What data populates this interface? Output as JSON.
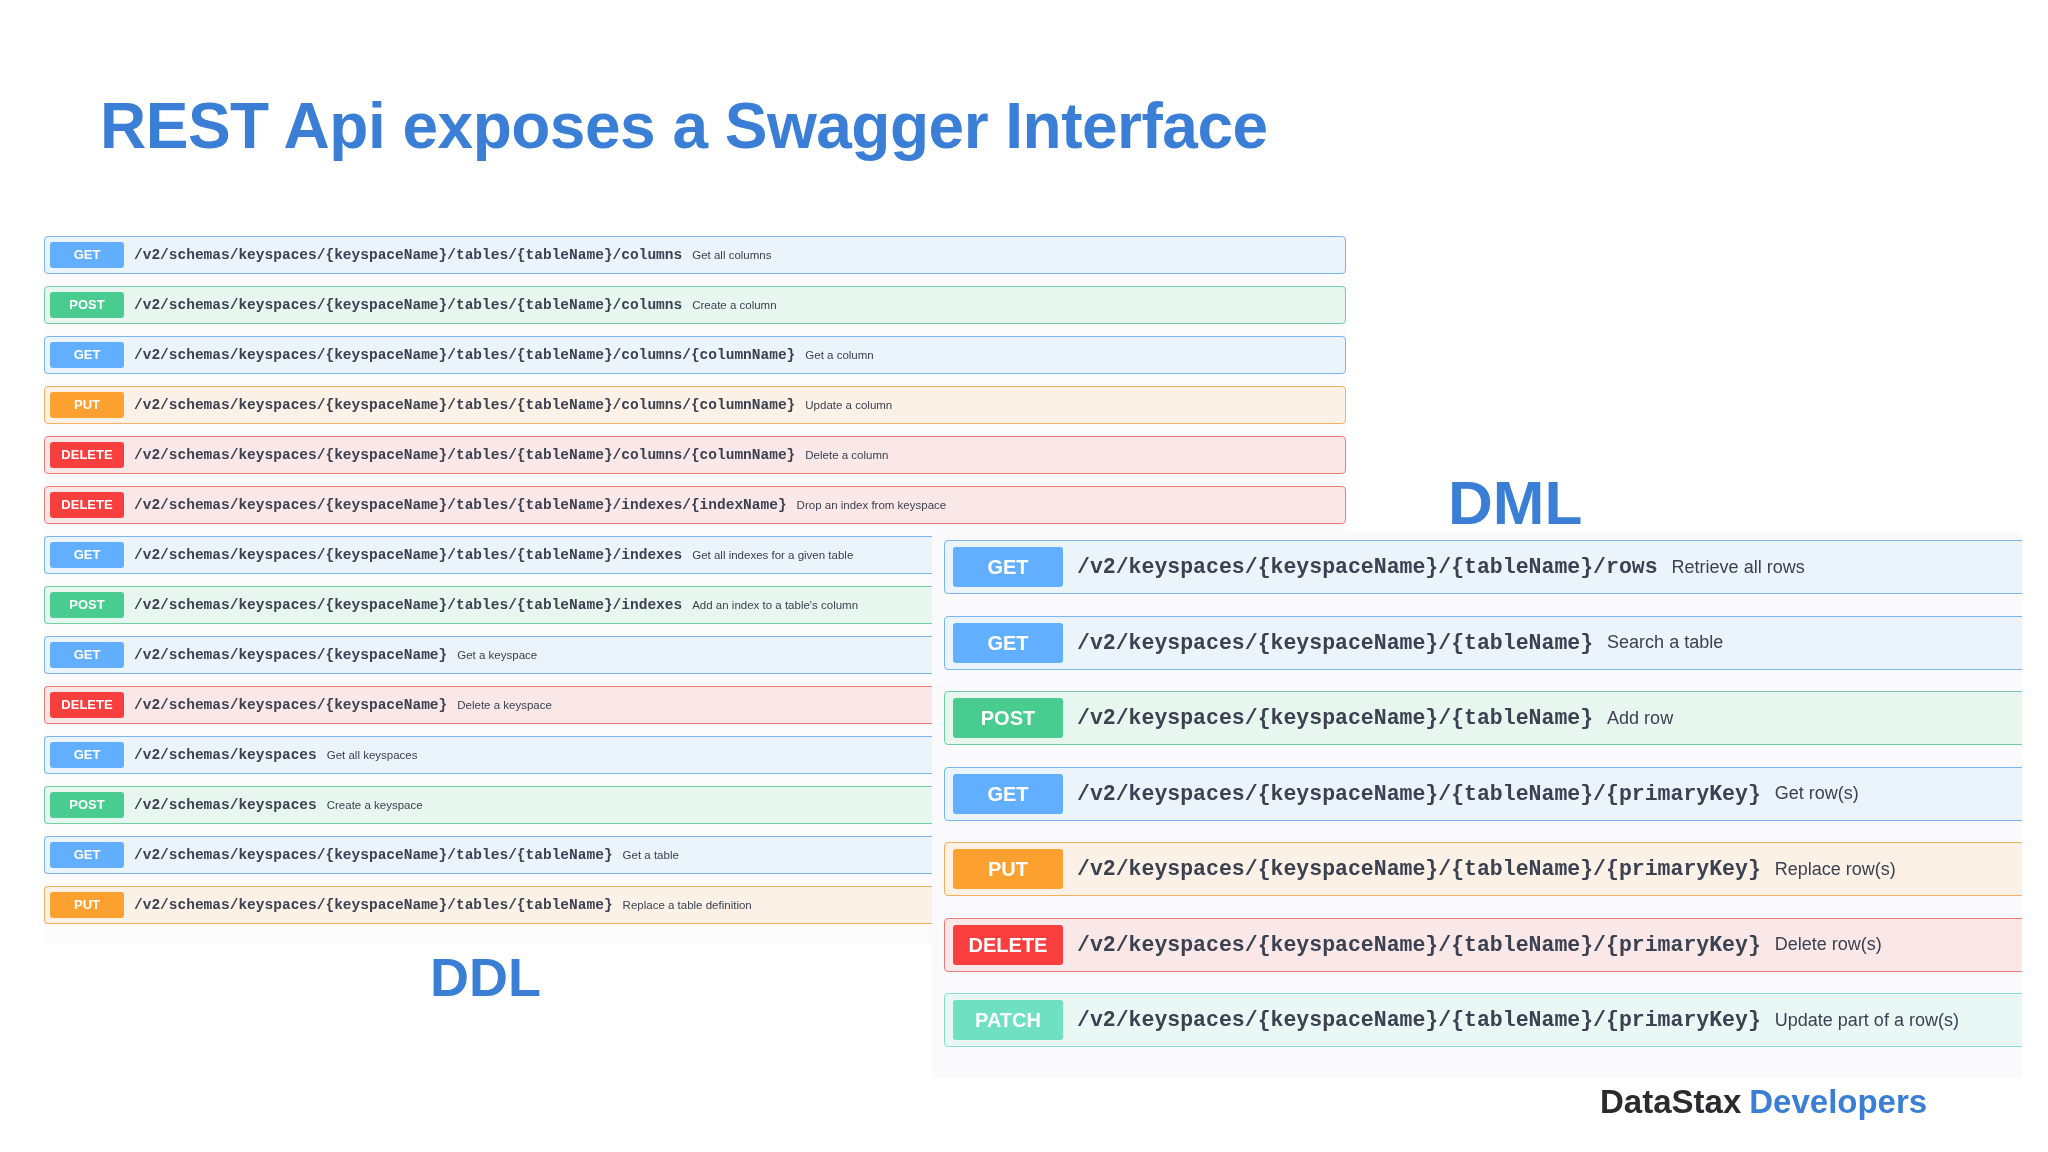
{
  "title": "REST Api exposes a Swagger Interface",
  "ddl": {
    "label": "DDL",
    "endpoints": [
      {
        "kind": "get",
        "method": "GET",
        "path": "/v2/schemas/keyspaces/{keyspaceName}/tables/{tableName}/columns",
        "summary": "Get all columns"
      },
      {
        "kind": "post",
        "method": "POST",
        "path": "/v2/schemas/keyspaces/{keyspaceName}/tables/{tableName}/columns",
        "summary": "Create a column"
      },
      {
        "kind": "get",
        "method": "GET",
        "path": "/v2/schemas/keyspaces/{keyspaceName}/tables/{tableName}/columns/{columnName}",
        "summary": "Get a column"
      },
      {
        "kind": "put",
        "method": "PUT",
        "path": "/v2/schemas/keyspaces/{keyspaceName}/tables/{tableName}/columns/{columnName}",
        "summary": "Update a column"
      },
      {
        "kind": "delete",
        "method": "DELETE",
        "path": "/v2/schemas/keyspaces/{keyspaceName}/tables/{tableName}/columns/{columnName}",
        "summary": "Delete a column"
      },
      {
        "kind": "delete",
        "method": "DELETE",
        "path": "/v2/schemas/keyspaces/{keyspaceName}/tables/{tableName}/indexes/{indexName}",
        "summary": "Drop an index from keyspace"
      },
      {
        "kind": "get",
        "method": "GET",
        "path": "/v2/schemas/keyspaces/{keyspaceName}/tables/{tableName}/indexes",
        "summary": "Get all indexes for a given table"
      },
      {
        "kind": "post",
        "method": "POST",
        "path": "/v2/schemas/keyspaces/{keyspaceName}/tables/{tableName}/indexes",
        "summary": "Add an index to a table's column"
      },
      {
        "kind": "get",
        "method": "GET",
        "path": "/v2/schemas/keyspaces/{keyspaceName}",
        "summary": "Get a keyspace"
      },
      {
        "kind": "delete",
        "method": "DELETE",
        "path": "/v2/schemas/keyspaces/{keyspaceName}",
        "summary": "Delete a keyspace"
      },
      {
        "kind": "get",
        "method": "GET",
        "path": "/v2/schemas/keyspaces",
        "summary": "Get all keyspaces"
      },
      {
        "kind": "post",
        "method": "POST",
        "path": "/v2/schemas/keyspaces",
        "summary": "Create a keyspace"
      },
      {
        "kind": "get",
        "method": "GET",
        "path": "/v2/schemas/keyspaces/{keyspaceName}/tables/{tableName}",
        "summary": "Get a table"
      },
      {
        "kind": "put",
        "method": "PUT",
        "path": "/v2/schemas/keyspaces/{keyspaceName}/tables/{tableName}",
        "summary": "Replace a table definition"
      }
    ]
  },
  "dml": {
    "label": "DML",
    "endpoints": [
      {
        "kind": "get",
        "method": "GET",
        "path": "/v2/keyspaces/{keyspaceName}/{tableName}/rows",
        "summary": "Retrieve all rows"
      },
      {
        "kind": "get",
        "method": "GET",
        "path": "/v2/keyspaces/{keyspaceName}/{tableName}",
        "summary": "Search a table"
      },
      {
        "kind": "post",
        "method": "POST",
        "path": "/v2/keyspaces/{keyspaceName}/{tableName}",
        "summary": "Add row"
      },
      {
        "kind": "get",
        "method": "GET",
        "path": "/v2/keyspaces/{keyspaceName}/{tableName}/{primaryKey}",
        "summary": "Get row(s)"
      },
      {
        "kind": "put",
        "method": "PUT",
        "path": "/v2/keyspaces/{keyspaceName}/{tableName}/{primaryKey}",
        "summary": "Replace row(s)"
      },
      {
        "kind": "delete",
        "method": "DELETE",
        "path": "/v2/keyspaces/{keyspaceName}/{tableName}/{primaryKey}",
        "summary": "Delete row(s)"
      },
      {
        "kind": "patch",
        "method": "PATCH",
        "path": "/v2/keyspaces/{keyspaceName}/{tableName}/{primaryKey}",
        "summary": "Update part of a row(s)"
      }
    ]
  },
  "brand": {
    "name": "DataStax",
    "suffix": "Developers"
  }
}
